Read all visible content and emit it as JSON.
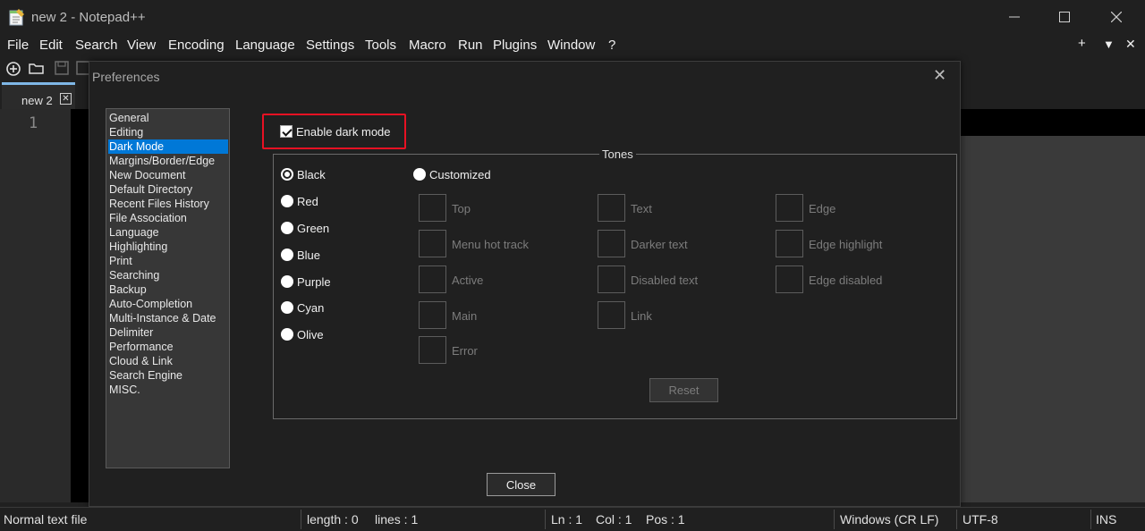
{
  "window": {
    "title": "new 2 - Notepad++"
  },
  "menu": [
    "File",
    "Edit",
    "Search",
    "View",
    "Encoding",
    "Language",
    "Settings",
    "Tools",
    "Macro",
    "Run",
    "Plugins",
    "Window",
    "?"
  ],
  "menu_right": {
    "add": "+",
    "dropdown": "▼",
    "close": "✕"
  },
  "tab": {
    "label": "new 2",
    "close": "✕"
  },
  "editor": {
    "line_number": "1"
  },
  "dialog": {
    "title": "Preferences",
    "close_glyph": "✕",
    "categories": [
      "General",
      "Editing",
      "Dark Mode",
      "Margins/Border/Edge",
      "New Document",
      "Default Directory",
      "Recent Files History",
      "File Association",
      "Language",
      "Highlighting",
      "Print",
      "Searching",
      "Backup",
      "Auto-Completion",
      "Multi-Instance & Date",
      "Delimiter",
      "Performance",
      "Cloud & Link",
      "Search Engine",
      "MISC."
    ],
    "selected_category": "Dark Mode",
    "enable_dark_mode": {
      "label": "Enable dark mode",
      "checked": true
    },
    "tones": {
      "legend": "Tones",
      "presets": [
        "Black",
        "Red",
        "Green",
        "Blue",
        "Purple",
        "Cyan",
        "Olive"
      ],
      "selected": "Black",
      "customized_label": "Customized",
      "colors_col1": [
        "Top",
        "Menu hot track",
        "Active",
        "Main",
        "Error"
      ],
      "colors_col2": [
        "Text",
        "Darker text",
        "Disabled text",
        "Link"
      ],
      "colors_col3": [
        "Edge",
        "Edge highlight",
        "Edge disabled"
      ],
      "reset_label": "Reset"
    },
    "close_label": "Close"
  },
  "status": {
    "file_type": "Normal text file",
    "length": "length : 0",
    "lines": "lines : 1",
    "ln": "Ln : 1",
    "col": "Col : 1",
    "pos": "Pos : 1",
    "eol": "Windows (CR LF)",
    "encoding": "UTF-8",
    "mode": "INS"
  },
  "colors": {
    "accent": "#0078d7",
    "highlight_border": "#e81123",
    "background": "#202020"
  }
}
